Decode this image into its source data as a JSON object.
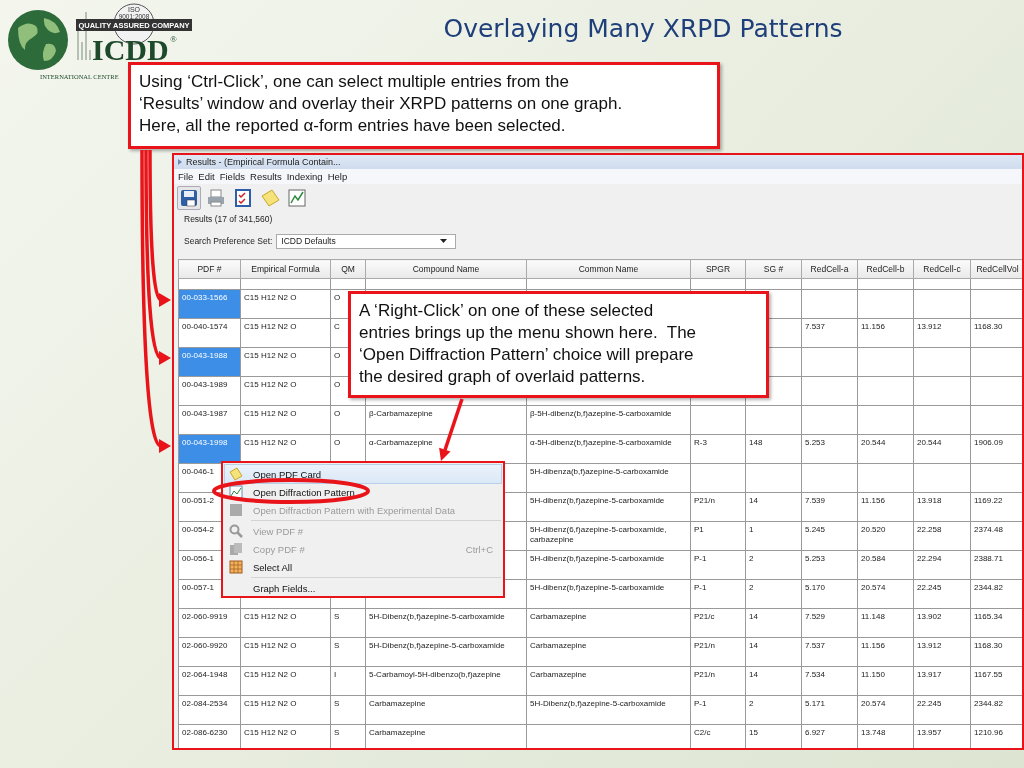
{
  "logo": {
    "badge": [
      "ISO",
      "9001:2008",
      "QUALITY ASSURED COMPANY"
    ],
    "name": "ICDD",
    "mark": "®",
    "subtitle": "INTERNATIONAL CENTRE"
  },
  "title": "Overlaying Many XRPD Patterns",
  "callouts": [
    {
      "text": "Using ‘Ctrl-Click’, one can select multiple entries from the\n‘Results’ window and overlay their XRPD patterns on one graph.\nHere, all the reported α-form entries have been selected."
    },
    {
      "text": "A ‘Right-Click’ on one of these selected\nentries brings up the menu shown here.  The\n‘Open Diffraction Pattern’ choice will prepare\nthe desired graph of overlaid patterns."
    }
  ],
  "window": {
    "title": "Results - (Empirical Formula Contain...",
    "menu": [
      "File",
      "Edit",
      "Fields",
      "Results",
      "Indexing",
      "Help"
    ],
    "results_count": "Results (17 of 341,560)",
    "search_preference": {
      "label": "Search Preference Set:",
      "value": "ICDD Defaults"
    },
    "table": {
      "columns": [
        "PDF #",
        "Empirical Formula",
        "QM",
        "Compound Name",
        "Common Name",
        "SPGR",
        "SG #",
        "RedCell-a",
        "RedCell-b",
        "RedCell-c",
        "RedCellVol"
      ],
      "rows": [
        {
          "selected": true,
          "pdf": "00-033-1566",
          "formula": "C15 H12 N2 O",
          "qm": "O"
        },
        {
          "selected": false,
          "pdf": "00-040-1574",
          "formula": "C15 H12 N2 O",
          "qm": "C",
          "a": "7.537",
          "b": "11.156",
          "c": "13.912",
          "vol": "1168.30"
        },
        {
          "selected": true,
          "pdf": "00-043-1988",
          "formula": "C15 H12 N2 O",
          "qm": "O"
        },
        {
          "selected": false,
          "pdf": "00-043-1989",
          "formula": "C15 H12 N2 O",
          "qm": "O"
        },
        {
          "selected": false,
          "pdf": "00-043-1987",
          "formula": "C15 H12 N2 O",
          "qm": "O",
          "compound": "β-Carbamazepine",
          "common": "β-5H-dibenz(b,f)azepine-5-carboxamide"
        },
        {
          "selected": true,
          "pdf": "00-043-1998",
          "formula": "C15 H12 N2 O",
          "qm": "O",
          "compound": "α-Carbamazepine",
          "common": "α-5H-dibenz(b,f)azepine-5-carboxamide",
          "spgr": "R-3",
          "sg": "148",
          "a": "5.253",
          "b": "20.544",
          "c": "20.544",
          "vol": "1906.09"
        },
        {
          "selected": false,
          "pdf": "00-046-1",
          "common": "5H-dibenza(b,f)azepine-5-carboxamide"
        },
        {
          "selected": false,
          "pdf": "00-051-2",
          "common": "5H-dibenz(b,f)azepine-5-carboxamide",
          "spgr": "P21/n",
          "sg": "14",
          "a": "7.539",
          "b": "11.156",
          "c": "13.918",
          "vol": "1169.22"
        },
        {
          "selected": false,
          "pdf": "00-054-2",
          "common": "5H-dibenz(6,f)azepine-5-carboxamide, carbazepine",
          "spgr": "P1",
          "sg": "1",
          "a": "5.245",
          "b": "20.520",
          "c": "22.258",
          "vol": "2374.48"
        },
        {
          "selected": false,
          "pdf": "00-056-1",
          "common": "5H-dibenz(b,f)azepine-5-carboxamide",
          "spgr": "P-1",
          "sg": "2",
          "a": "5.253",
          "b": "20.584",
          "c": "22.294",
          "vol": "2388.71"
        },
        {
          "selected": false,
          "pdf": "00-057-1",
          "common": "5H-dibenz(b,f)azepine-5-carboxamide",
          "spgr": "P-1",
          "sg": "2",
          "a": "5.170",
          "b": "20.574",
          "c": "22.245",
          "vol": "2344.82"
        },
        {
          "selected": false,
          "pdf": "02-060-9919",
          "formula": "C15 H12 N2 O",
          "qm": "S",
          "compound": "5H-Dibenz(b,f)azepine-5-carboxamide",
          "common": "Carbamazepine",
          "spgr": "P21/c",
          "sg": "14",
          "a": "7.529",
          "b": "11.148",
          "c": "13.902",
          "vol": "1165.34"
        },
        {
          "selected": false,
          "pdf": "02-060-9920",
          "formula": "C15 H12 N2 O",
          "qm": "S",
          "compound": "5H-Dibenz(b,f)azepine-5-carboxamide",
          "common": "Carbamazepine",
          "spgr": "P21/n",
          "sg": "14",
          "a": "7.537",
          "b": "11.156",
          "c": "13.912",
          "vol": "1168.30"
        },
        {
          "selected": false,
          "pdf": "02-064-1948",
          "formula": "C15 H12 N2 O",
          "qm": "I",
          "compound": "5-Carbamoyl-5H-dibenzo(b,f)azepine",
          "common": "Carbamazepine",
          "spgr": "P21/n",
          "sg": "14",
          "a": "7.534",
          "b": "11.150",
          "c": "13.917",
          "vol": "1167.55"
        },
        {
          "selected": false,
          "pdf": "02-084-2534",
          "formula": "C15 H12 N2 O",
          "qm": "S",
          "compound": "Carbamazepine",
          "common": "5H-Dibenz(b,f)azepine-5-carboxamide",
          "spgr": "P-1",
          "sg": "2",
          "a": "5.171",
          "b": "20.574",
          "c": "22.245",
          "vol": "2344.82"
        },
        {
          "selected": false,
          "pdf": "02-086-6230",
          "formula": "C15 H12 N2 O",
          "qm": "S",
          "compound": "Carbamazepine",
          "spgr": "C2/c",
          "sg": "15",
          "a": "6.927",
          "b": "13.748",
          "c": "13.957",
          "vol": "1210.96"
        }
      ]
    }
  },
  "context_menu": [
    {
      "kind": "item",
      "label": "Open PDF Card",
      "highlighted": true,
      "disabled": false
    },
    {
      "kind": "item",
      "label": "Open Diffraction Pattern",
      "highlighted": false,
      "disabled": false
    },
    {
      "kind": "item",
      "label": "Open Diffraction Pattern with Experimental Data",
      "highlighted": false,
      "disabled": true
    },
    {
      "kind": "separator"
    },
    {
      "kind": "item",
      "label": "View PDF #",
      "highlighted": false,
      "disabled": true
    },
    {
      "kind": "item",
      "label": "Copy PDF #",
      "shortcut": "Ctrl+C",
      "highlighted": false,
      "disabled": true
    },
    {
      "kind": "item",
      "label": "Select All",
      "highlighted": false,
      "disabled": false
    },
    {
      "kind": "separator"
    },
    {
      "kind": "item",
      "label": "Graph Fields...",
      "highlighted": false,
      "disabled": false
    }
  ]
}
